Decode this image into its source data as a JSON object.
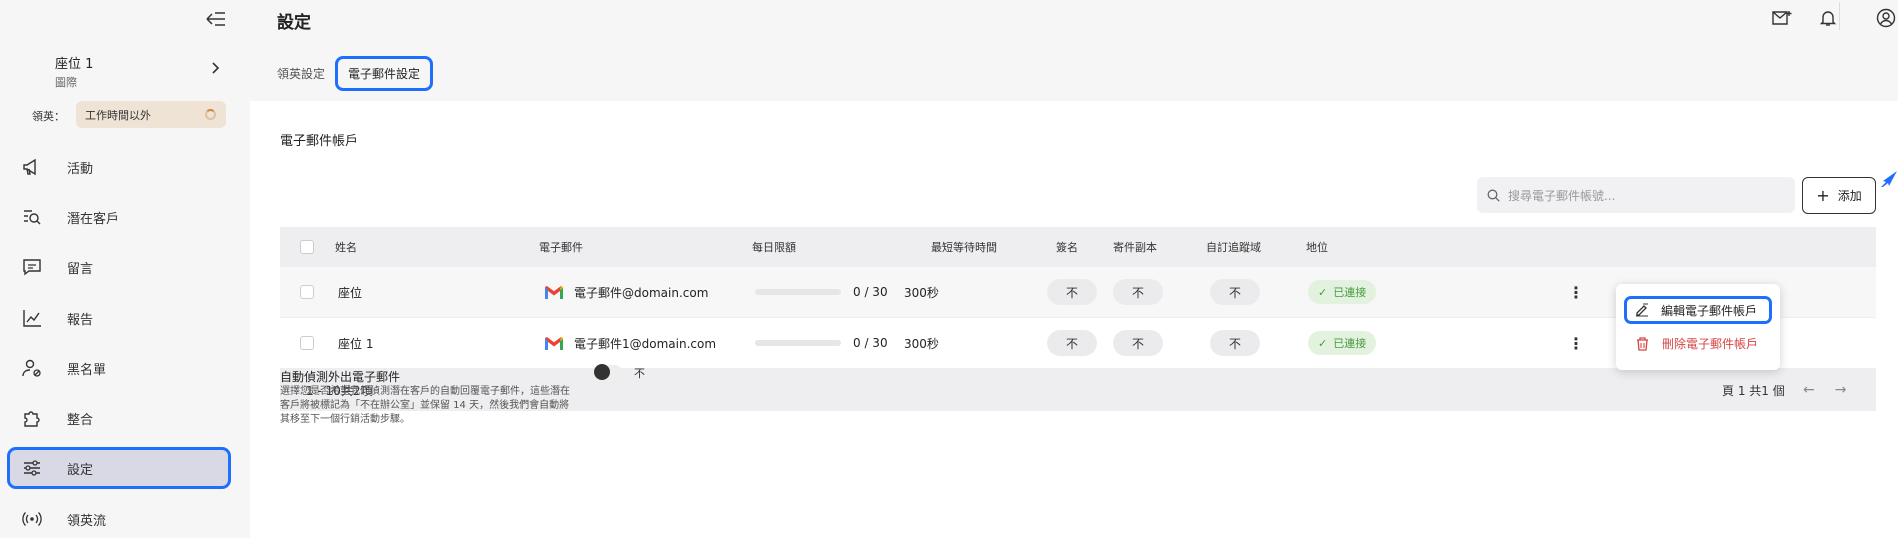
{
  "sidebar": {
    "seat_name": "座位 1",
    "seat_sub": "圖際",
    "leader_label": "領英：",
    "status": "工作時間以外",
    "items": [
      {
        "label": "活動",
        "icon": "megaphone-icon"
      },
      {
        "label": "潛在客戶",
        "icon": "search-list-icon"
      },
      {
        "label": "留言",
        "icon": "message-icon"
      },
      {
        "label": "報告",
        "icon": "chart-icon"
      },
      {
        "label": "黑名單",
        "icon": "user-block-icon"
      },
      {
        "label": "整合",
        "icon": "puzzle-icon"
      },
      {
        "label": "設定",
        "icon": "sliders-icon"
      },
      {
        "label": "領英流",
        "icon": "broadcast-icon"
      }
    ]
  },
  "header": {
    "title": "設定"
  },
  "tabs": [
    {
      "label": "領英設定"
    },
    {
      "label": "電子郵件設定"
    }
  ],
  "email": {
    "section_title": "電子郵件帳戶",
    "search_placeholder": "搜尋電子郵件帳號...",
    "add_label": "添加",
    "columns": [
      "姓名",
      "電子郵件",
      "每日限額",
      "最短等待時間",
      "簽名",
      "寄件副本",
      "自訂追蹤域",
      "地位"
    ],
    "rows": [
      {
        "name": "座位",
        "email": "電子郵件@domain.com",
        "limit": "0 / 30",
        "limit_fraction": 0,
        "wait": "300秒",
        "signature": "不",
        "cc": "不",
        "domain": "不",
        "status": "已連接"
      },
      {
        "name": "座位 1",
        "email": "電子郵件1@domain.com",
        "limit": "0 / 30",
        "limit_fraction": 0,
        "wait": "300秒",
        "signature": "不",
        "cc": "不",
        "domain": "不",
        "status": "已連接"
      }
    ],
    "pager_range": "1 - 10共2項",
    "pager_page": "頁 1 共1 個",
    "menu": {
      "edit": "編輯電子郵件帳戶",
      "delete": "刪除電子郵件帳戶"
    }
  },
  "auto_detect": {
    "title": "自動偵測外出電子郵件",
    "description": "選擇您是否希望我們偵測潛在客戶的自動回覆電子郵件，這些潛在客戶將被標記為「不在辦公室」並保留 14 天，然後我們會自動將其移至下一個行銷活動步驟。",
    "toggle_label": "不",
    "enabled": false
  },
  "colors": {
    "accent": "#1f6fff",
    "connected": "#4a9a3f",
    "danger": "#d64545"
  }
}
